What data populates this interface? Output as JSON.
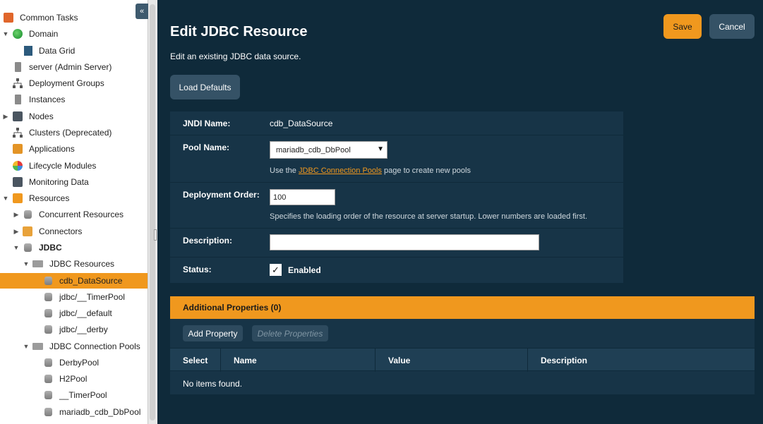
{
  "sidebar": {
    "items": [
      {
        "label": "Common Tasks",
        "icon": "tasks-icon"
      },
      {
        "label": "Domain",
        "icon": "globe-icon"
      },
      {
        "label": "Data Grid",
        "icon": "grid-icon"
      },
      {
        "label": "server (Admin Server)",
        "icon": "server-icon"
      },
      {
        "label": "Deployment Groups",
        "icon": "network-icon"
      },
      {
        "label": "Instances",
        "icon": "server-icon"
      },
      {
        "label": "Nodes",
        "icon": "nodes-icon"
      },
      {
        "label": "Clusters (Deprecated)",
        "icon": "network-icon"
      },
      {
        "label": "Applications",
        "icon": "applications-icon"
      },
      {
        "label": "Lifecycle Modules",
        "icon": "lifecycle-icon"
      },
      {
        "label": "Monitoring Data",
        "icon": "monitor-icon"
      },
      {
        "label": "Resources",
        "icon": "resources-icon"
      },
      {
        "label": "Concurrent Resources",
        "icon": "database-icon"
      },
      {
        "label": "Connectors",
        "icon": "connector-icon"
      },
      {
        "label": "JDBC",
        "icon": "database-icon"
      },
      {
        "label": "JDBC Resources",
        "icon": "folder-icon"
      },
      {
        "label": "cdb_DataSource",
        "icon": "database-icon"
      },
      {
        "label": "jdbc/__TimerPool",
        "icon": "database-icon"
      },
      {
        "label": "jdbc/__default",
        "icon": "database-icon"
      },
      {
        "label": "jdbc/__derby",
        "icon": "database-icon"
      },
      {
        "label": "JDBC Connection Pools",
        "icon": "folder-icon"
      },
      {
        "label": "DerbyPool",
        "icon": "database-icon"
      },
      {
        "label": "H2Pool",
        "icon": "database-icon"
      },
      {
        "label": "__TimerPool",
        "icon": "database-icon"
      },
      {
        "label": "mariadb_cdb_DbPool",
        "icon": "database-icon"
      }
    ],
    "collapse_glyph": "«"
  },
  "header": {
    "title": "Edit JDBC Resource",
    "subtitle": "Edit an existing JDBC data source.",
    "save_label": "Save",
    "cancel_label": "Cancel",
    "load_defaults_label": "Load Defaults"
  },
  "form": {
    "jndi_label": "JNDI Name:",
    "jndi_value": "cdb_DataSource",
    "pool_label": "Pool Name:",
    "pool_value": "mariadb_cdb_DbPool",
    "pool_help_prefix": "Use the ",
    "pool_help_link": "JDBC Connection Pools",
    "pool_help_suffix": " page to create new pools",
    "order_label": "Deployment Order:",
    "order_value": "100",
    "order_help": "Specifies the loading order of the resource at server startup. Lower numbers are loaded first.",
    "description_label": "Description:",
    "description_value": "",
    "status_label": "Status:",
    "status_checked_glyph": "✓",
    "status_value": "Enabled"
  },
  "additional": {
    "header": "Additional Properties (0)",
    "add_label": "Add Property",
    "delete_label": "Delete Properties",
    "columns": [
      "Select",
      "Name",
      "Value",
      "Description"
    ],
    "empty_text": "No items found."
  },
  "colors": {
    "accent": "#f0981e",
    "background": "#0f2a3a",
    "panel": "#173447"
  }
}
